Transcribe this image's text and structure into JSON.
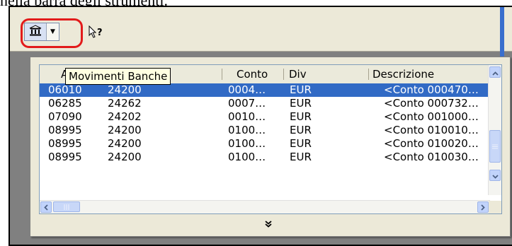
{
  "document": {
    "text": "nella barra degli strumenti."
  },
  "toolbar": {
    "bank_button_icon": "bank-icon",
    "dropdown_icon": "caret-down-icon",
    "help_icon": "help-pointer-icon",
    "highlight_color": "#e21b1b"
  },
  "tooltip": {
    "text": "Movimenti Banche"
  },
  "table": {
    "columns": [
      "A",
      "",
      "Conto",
      "Div",
      "Descrizione"
    ],
    "rows": [
      [
        "06010",
        "24200",
        "0004…",
        "EUR",
        "<Conto 000470…"
      ],
      [
        "06285",
        "24262",
        "0007…",
        "EUR",
        "<Conto 000732…"
      ],
      [
        "07090",
        "24202",
        "0010…",
        "EUR",
        "<Conto 001000…"
      ],
      [
        "08995",
        "24200",
        "0100…",
        "EUR",
        "<Conto 010010…"
      ],
      [
        "08995",
        "24200",
        "0100…",
        "EUR",
        "<Conto 010020…"
      ],
      [
        "08995",
        "24200",
        "0100…",
        "EUR",
        "<Conto 010030…"
      ]
    ],
    "selected_row_index": 0,
    "selection_color": "#316ac5"
  },
  "scrollbars": {
    "up_icon": "scroll-up-icon",
    "down_icon": "scroll-down-icon",
    "left_icon": "scroll-left-icon",
    "right_icon": "scroll-right-icon"
  },
  "expand_icon": "double-chevron-down-icon"
}
